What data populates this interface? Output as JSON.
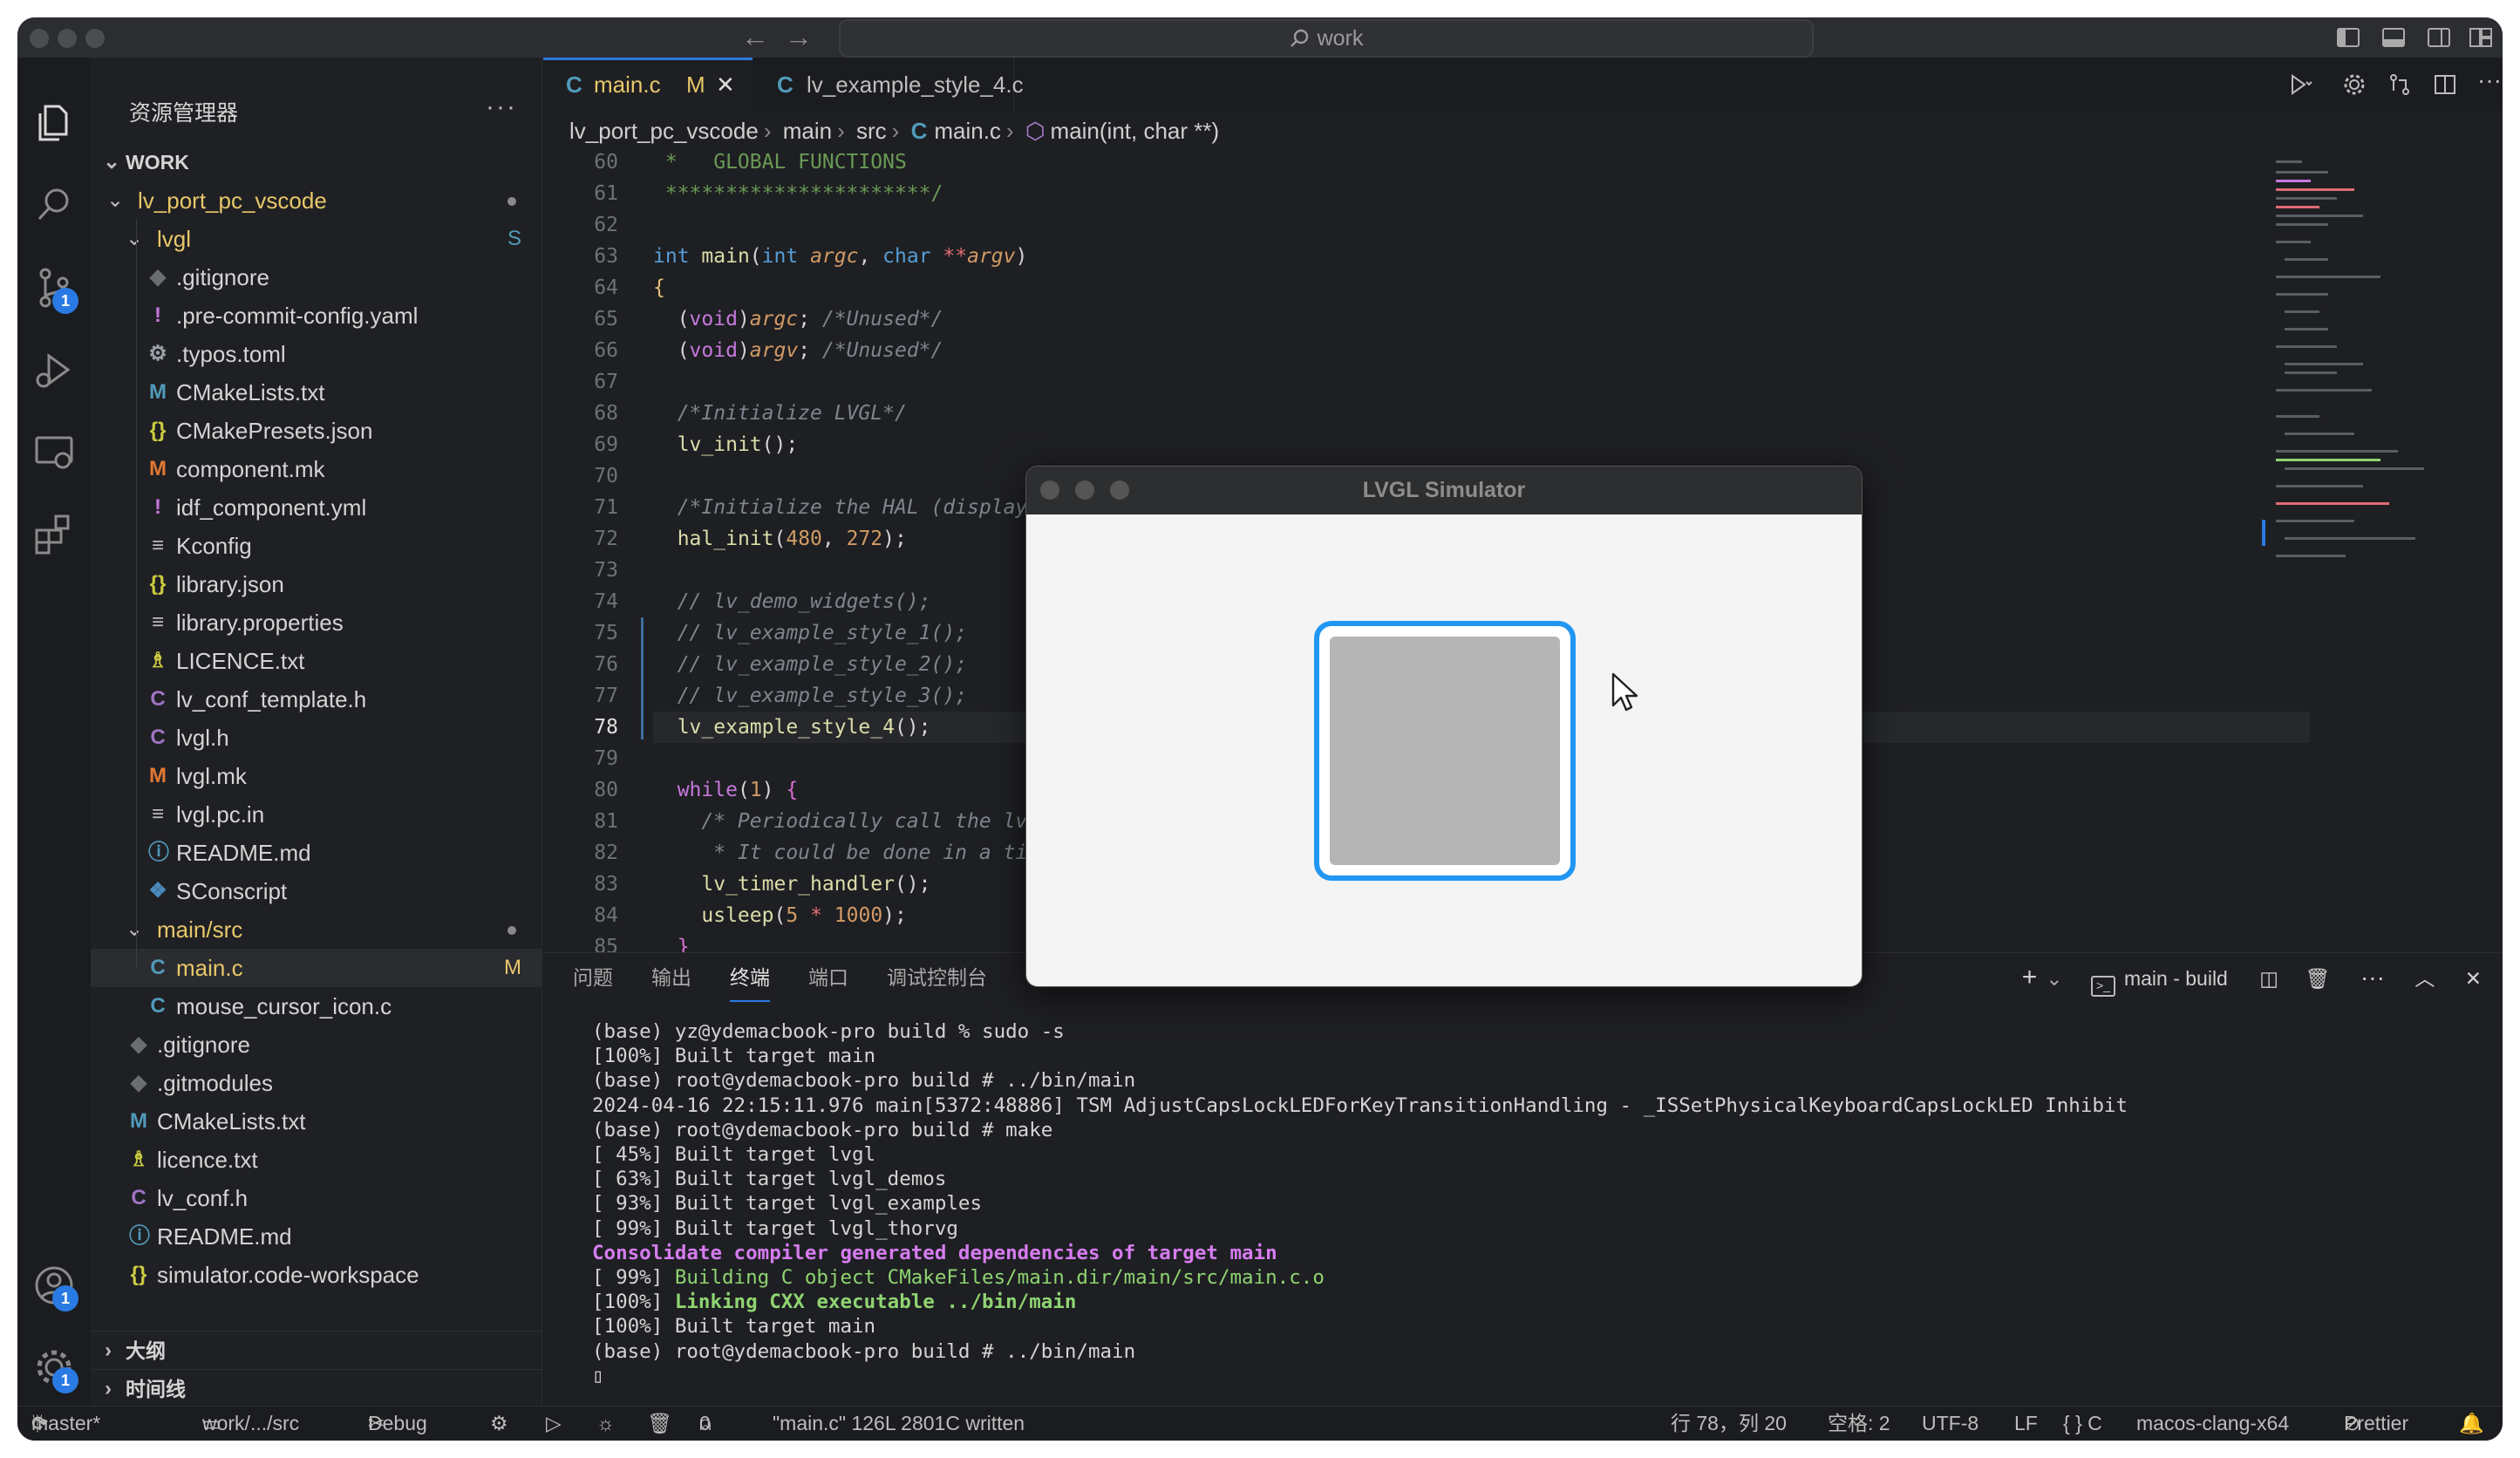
{
  "window": {
    "search": "work"
  },
  "activity_badges": {
    "scm": "1",
    "accounts": "1",
    "settings": "1"
  },
  "sidebar": {
    "title": "资源管理器",
    "more": "···",
    "section": "WORK",
    "rows": [
      {
        "label": "lv_port_pc_vscode",
        "type": "folder-open",
        "indent": 0,
        "color": "#e8c76a",
        "dot": true
      },
      {
        "label": "lvgl",
        "type": "folder-open",
        "indent": 1,
        "color": "#e8c76a",
        "mark": "S"
      },
      {
        "label": ".gitignore",
        "icon": "◆",
        "iconColor": "#6b6d72",
        "indent": 2
      },
      {
        "label": ".pre-commit-config.yaml",
        "icon": "!",
        "iconColor": "#c678dd",
        "indent": 2
      },
      {
        "label": ".typos.toml",
        "icon": "⚙",
        "iconColor": "#9aa0a6",
        "indent": 2
      },
      {
        "label": "CMakeLists.txt",
        "icon": "M",
        "iconColor": "#519aba",
        "indent": 2
      },
      {
        "label": "CMakePresets.json",
        "icon": "{}",
        "iconColor": "#cbcb41",
        "indent": 2
      },
      {
        "label": "component.mk",
        "icon": "M",
        "iconColor": "#e37933",
        "indent": 2
      },
      {
        "label": "idf_component.yml",
        "icon": "!",
        "iconColor": "#c678dd",
        "indent": 2
      },
      {
        "label": "Kconfig",
        "icon": "≡",
        "iconColor": "#bbbbbb",
        "indent": 2
      },
      {
        "label": "library.json",
        "icon": "{}",
        "iconColor": "#cbcb41",
        "indent": 2
      },
      {
        "label": "library.properties",
        "icon": "≡",
        "iconColor": "#bbbbbb",
        "indent": 2
      },
      {
        "label": "LICENCE.txt",
        "icon": "♗",
        "iconColor": "#cbcb41",
        "indent": 2
      },
      {
        "label": "lv_conf_template.h",
        "icon": "C",
        "iconColor": "#a074c4",
        "indent": 2
      },
      {
        "label": "lvgl.h",
        "icon": "C",
        "iconColor": "#a074c4",
        "indent": 2
      },
      {
        "label": "lvgl.mk",
        "icon": "M",
        "iconColor": "#e37933",
        "indent": 2
      },
      {
        "label": "lvgl.pc.in",
        "icon": "≡",
        "iconColor": "#bbbbbb",
        "indent": 2
      },
      {
        "label": "README.md",
        "icon": "ⓘ",
        "iconColor": "#519aba",
        "indent": 2
      },
      {
        "label": "SConscript",
        "icon": "❖",
        "iconColor": "#4b8bbe",
        "indent": 2
      },
      {
        "label": "main/src",
        "type": "folder-open",
        "indent": 1,
        "color": "#e8c76a",
        "dot": true
      },
      {
        "label": "main.c",
        "icon": "C",
        "iconColor": "#519aba",
        "indent": 2,
        "color": "#e8c76a",
        "mark": "M",
        "selected": true
      },
      {
        "label": "mouse_cursor_icon.c",
        "icon": "C",
        "iconColor": "#519aba",
        "indent": 2
      },
      {
        "label": ".gitignore",
        "icon": "◆",
        "iconColor": "#6b6d72",
        "indent": 1
      },
      {
        "label": ".gitmodules",
        "icon": "◆",
        "iconColor": "#6b6d72",
        "indent": 1
      },
      {
        "label": "CMakeLists.txt",
        "icon": "M",
        "iconColor": "#519aba",
        "indent": 1
      },
      {
        "label": "licence.txt",
        "icon": "♗",
        "iconColor": "#cbcb41",
        "indent": 1
      },
      {
        "label": "lv_conf.h",
        "icon": "C",
        "iconColor": "#a074c4",
        "indent": 1
      },
      {
        "label": "README.md",
        "icon": "ⓘ",
        "iconColor": "#519aba",
        "indent": 1
      },
      {
        "label": "simulator.code-workspace",
        "icon": "{}",
        "iconColor": "#cbcb41",
        "indent": 1
      }
    ],
    "outline": "大纲",
    "timeline": "时间线"
  },
  "tabs": [
    {
      "label": "main.c",
      "modified": "M",
      "active": true
    },
    {
      "label": "lv_example_style_4.c",
      "active": false
    }
  ],
  "breadcrumb": [
    "lv_port_pc_vscode",
    "main",
    "src",
    "main.c",
    "main(int, char **)"
  ],
  "code": {
    "current_line": "78",
    "lines": [
      {
        "n": "60",
        "html": "<span style='color:#6a9955'> *   GLOBAL FUNCTIONS</span>"
      },
      {
        "n": "61",
        "html": "<span style='color:#6a9955'> **********************/</span>"
      },
      {
        "n": "62",
        "html": ""
      },
      {
        "n": "63",
        "html": "<span style='color:#569cd6'>int</span> <span style='color:#dcdcaa'>main</span>(<span style='color:#569cd6'>int</span> <i style='color:#d19a66'>argc</i>, <span style='color:#569cd6'>char</span> <span style='color:#e06c75'>**</span><i style='color:#d19a66'>argv</i>)"
      },
      {
        "n": "64",
        "html": "<span style='color:#e5c07b'>{</span>"
      },
      {
        "n": "65",
        "html": "  (<span style='color:#c678dd'>void</span>)<i style='color:#d19a66'>argc</i>; <i style='color:#7f848e'>/*Unused*/</i>"
      },
      {
        "n": "66",
        "html": "  (<span style='color:#c678dd'>void</span>)<i style='color:#d19a66'>argv</i>; <i style='color:#7f848e'>/*Unused*/</i>"
      },
      {
        "n": "67",
        "html": ""
      },
      {
        "n": "68",
        "html": "  <i style='color:#7f848e'>/*Initialize LVGL*/</i>"
      },
      {
        "n": "69",
        "html": "  <span style='color:#dcdcaa'>lv_init</span>();"
      },
      {
        "n": "70",
        "html": ""
      },
      {
        "n": "71",
        "html": "  <i style='color:#7f848e'>/*Initialize the HAL (display, input devices, tick) for LVGL*/</i>"
      },
      {
        "n": "72",
        "html": "  <span style='color:#dcdcaa'>hal_init</span>(<span style='color:#d19a66'>480</span>, <span style='color:#d19a66'>272</span>);"
      },
      {
        "n": "73",
        "html": ""
      },
      {
        "n": "74",
        "html": "  <i style='color:#7f848e'>// lv_demo_widgets();</i>"
      },
      {
        "n": "75",
        "html": "  <i style='color:#7f848e'>// lv_example_style_1();</i>"
      },
      {
        "n": "76",
        "html": "  <i style='color:#7f848e'>// lv_example_style_2();</i>"
      },
      {
        "n": "77",
        "html": "  <i style='color:#7f848e'>// lv_example_style_3();</i>"
      },
      {
        "n": "78",
        "html": "  <span style='color:#dcdcaa'>lv_example_style_4</span>();"
      },
      {
        "n": "79",
        "html": ""
      },
      {
        "n": "80",
        "html": "  <span style='color:#c678dd'>while</span>(<span style='color:#d19a66'>1</span>) <span style='color:#da70d6'>{</span>"
      },
      {
        "n": "81",
        "html": "    <i style='color:#7f848e'>/* Periodically call the lv_task handler.</i>"
      },
      {
        "n": "82",
        "html": "<i style='color:#7f848e'>     * It could be done in a timer interrupt or an OS task too.*/</i>"
      },
      {
        "n": "83",
        "html": "    <span style='color:#dcdcaa'>lv_timer_handler</span>();"
      },
      {
        "n": "84",
        "html": "    <span style='color:#dcdcaa'>usleep</span>(<span style='color:#d19a66'>5</span> <span style='color:#e06c75'>*</span> <span style='color:#d19a66'>1000</span>);"
      },
      {
        "n": "85",
        "html": "  <span style='color:#da70d6'>}</span>"
      }
    ]
  },
  "panel": {
    "tabs": [
      "问题",
      "输出",
      "终端",
      "端口",
      "调试控制台"
    ],
    "active_tab": "终端",
    "terminal_name": "main - build",
    "terminal": [
      {
        "t": "(base) yz@ydemacbook-pro build % sudo -s"
      },
      {
        "t": "[100%] Built target main"
      },
      {
        "t": "(base) root@ydemacbook-pro build # ../bin/main"
      },
      {
        "t": "2024-04-16 22:15:11.976 main[5372:48886] TSM AdjustCapsLockLEDForKeyTransitionHandling - _ISSetPhysicalKeyboardCapsLockLED Inhibit"
      },
      {
        "t": "(base) root@ydemacbook-pro build # make"
      },
      {
        "t": "[ 45%] Built target lvgl"
      },
      {
        "t": "[ 63%] Built target lvgl_demos"
      },
      {
        "t": "[ 93%] Built target lvgl_examples"
      },
      {
        "t": "[ 99%] Built target lvgl_thorvg"
      },
      {
        "t": "Consolidate compiler generated dependencies of target main",
        "cls": "tmag"
      },
      {
        "t": "[ 99%] Building C object CMakeFiles/main.dir/main/src/main.c.o",
        "pre": "[ 99%] ",
        "rest": "Building C object CMakeFiles/main.dir/main/src/main.c.o",
        "restColor": "#8fd472"
      },
      {
        "t": "[100%] Linking CXX executable ../bin/main",
        "pre": "[100%] ",
        "rest": "Linking CXX executable ../bin/main",
        "restColor": "#8fd472",
        "bold": true
      },
      {
        "t": "[100%] Built target main"
      },
      {
        "t": "(base) root@ydemacbook-pro build # ../bin/main"
      },
      {
        "t": "▯"
      }
    ]
  },
  "status": {
    "branch": "master*",
    "folder": "work/.../src",
    "debug": "Debug",
    "ports": "0",
    "message": "\"main.c\" 126L 2801C written",
    "position": "行 78，列 20",
    "spaces": "空格: 2",
    "encoding": "UTF-8",
    "eol": "LF",
    "language": "{ } C",
    "config": "macos-clang-x64",
    "prettier": "Prettier"
  },
  "simulator": {
    "title": "LVGL Simulator"
  },
  "colors": {
    "accent": "#2a7ae4",
    "lvgl_border": "#2196f3"
  }
}
